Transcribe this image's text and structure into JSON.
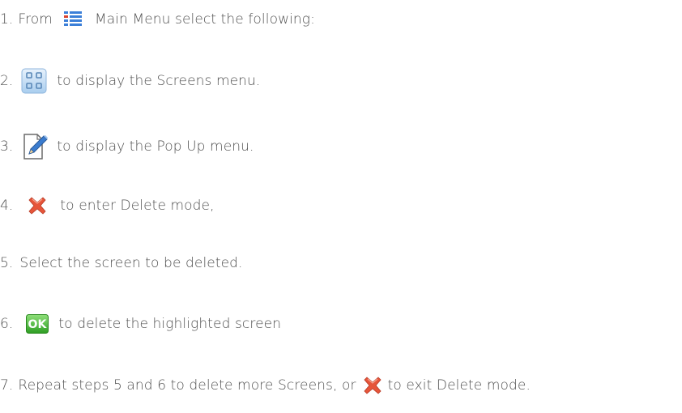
{
  "steps": [
    {
      "num": "1.",
      "before": "From",
      "icon": "main-menu-list-icon",
      "text": "Main Menu select the following:"
    },
    {
      "num": "2.",
      "icon": "screens-grid-icon",
      "text": "to display the Screens menu."
    },
    {
      "num": "3.",
      "icon": "edit-pencil-icon",
      "text": "to display the Pop Up menu."
    },
    {
      "num": "4.",
      "icon": "delete-x-icon",
      "text": "to enter Delete mode,"
    },
    {
      "num": "5.",
      "text": "Select the screen to be deleted."
    },
    {
      "num": "6.",
      "icon": "ok-button-icon",
      "icon_text": "OK",
      "text": "to delete the highlighted screen"
    },
    {
      "num": "7.",
      "text": "Repeat steps 5 and 6 to delete more Screens, or",
      "icon": "delete-x-icon",
      "text_after": "to exit Delete mode."
    }
  ],
  "colors": {
    "text": "#505050",
    "menu_icon_blue": "#3b7fd8",
    "menu_icon_red": "#d8432f",
    "grid_icon_bg": "#cfe3f7",
    "delete_icon_red": "#e6553a",
    "ok_green": "#37b02e"
  }
}
